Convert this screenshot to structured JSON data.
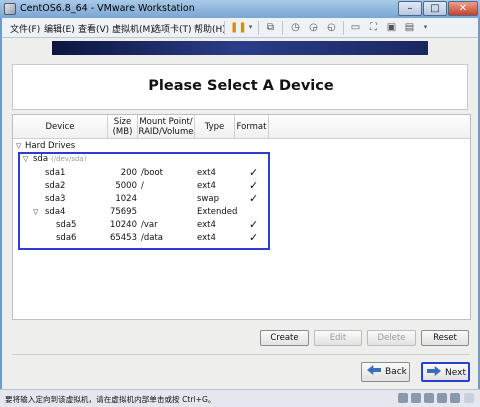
{
  "window": {
    "title": "CentOS6.8_64 - VMware Workstation",
    "controls": {
      "minimize": "–",
      "maximize": "□",
      "close": "✕"
    }
  },
  "menubar": {
    "items": [
      "文件(F)",
      "编辑(E)",
      "查看(V)",
      "虚拟机(M)",
      "选项卡(T)",
      "帮助(H)"
    ]
  },
  "toolbar_icons": [
    "pause-icon",
    "send-ctrl-alt-del-icon",
    "snapshot-icon",
    "revert-snapshot-icon",
    "snapshot-manager-icon",
    "view-console-icon",
    "fullscreen-icon",
    "unity-icon",
    "thumbnail-icon"
  ],
  "installer": {
    "heading": "Please Select A Device",
    "columns": {
      "device": "Device",
      "size": "Size\n(MB)",
      "mount": "Mount Point/\nRAID/Volume",
      "type": "Type",
      "format": "Format"
    },
    "group": "Hard Drives",
    "disk": {
      "name": "sda",
      "path": "(/dev/sda)"
    },
    "rows": [
      {
        "device": "sda1",
        "size": "200",
        "mount": "/boot",
        "type": "ext4",
        "format": true
      },
      {
        "device": "sda2",
        "size": "5000",
        "mount": "/",
        "type": "ext4",
        "format": true
      },
      {
        "device": "sda3",
        "size": "1024",
        "mount": "",
        "type": "swap",
        "format": true
      },
      {
        "device": "sda4",
        "size": "75695",
        "mount": "",
        "type": "Extended",
        "format": false
      },
      {
        "device": "sda5",
        "size": "10240",
        "mount": "/var",
        "type": "ext4",
        "format": true
      },
      {
        "device": "sda6",
        "size": "65453",
        "mount": "/data",
        "type": "ext4",
        "format": true
      }
    ],
    "buttons": {
      "create": "Create",
      "edit": "Edit",
      "delete": "Delete",
      "reset": "Reset",
      "back": "Back",
      "next": "Next"
    },
    "check_mark": "✓",
    "expanded_marker": "▽"
  },
  "status": {
    "text": "要将输入定向到该虚拟机，请在虚拟机内部单击或按 Ctrl+G。"
  },
  "colors": {
    "accent_border": "#2a3ed6",
    "banner": "#1a2760",
    "titlebar": "#7aa6d2"
  }
}
